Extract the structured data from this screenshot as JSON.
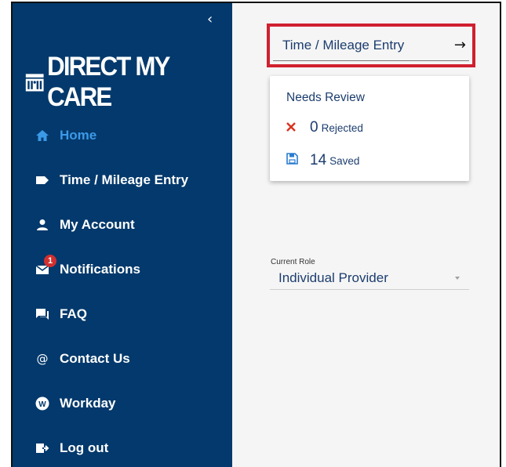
{
  "sidebar": {
    "collapse_icon": "chevron-left-icon",
    "logo_text": "DIRECT MY CARE",
    "items": [
      {
        "label": "Home",
        "icon": "home-icon",
        "active": true
      },
      {
        "label": "Time / Mileage Entry",
        "icon": "tag-icon"
      },
      {
        "label": "My Account",
        "icon": "person-icon"
      },
      {
        "label": "Notifications",
        "icon": "mail-icon",
        "badge": "1"
      },
      {
        "label": "FAQ",
        "icon": "chat-icon"
      },
      {
        "label": "Contact Us",
        "icon": "at-icon"
      },
      {
        "label": "Workday",
        "icon": "workday-icon"
      },
      {
        "label": "Log out",
        "icon": "logout-icon"
      }
    ]
  },
  "main": {
    "entry_field": {
      "label": "Time / Mileage Entry",
      "icon": "arrow-right-icon"
    },
    "review_card": {
      "title": "Needs Review",
      "rejected": {
        "count": "0",
        "label": "Rejected",
        "icon": "close-icon"
      },
      "saved": {
        "count": "14",
        "label": "Saved",
        "icon": "save-icon"
      }
    },
    "role": {
      "label": "Current Role",
      "value": "Individual Provider"
    }
  },
  "colors": {
    "sidebar_bg": "#03396c",
    "active": "#3b9ae8",
    "highlight": "#d0202f",
    "text": "#1c3d6e",
    "rejected": "#d9331f"
  }
}
